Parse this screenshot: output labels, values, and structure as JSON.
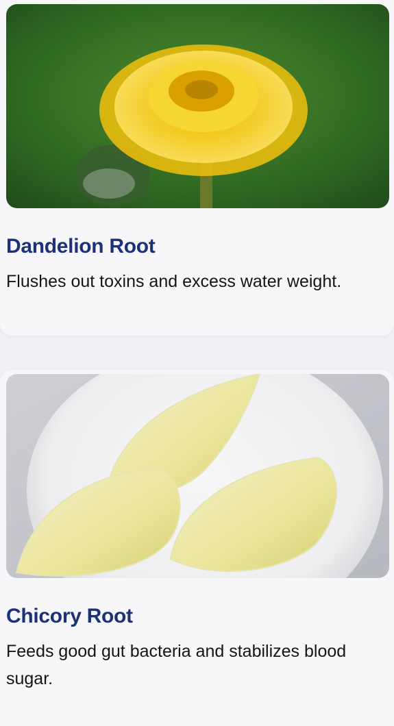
{
  "cards": [
    {
      "image_subject": "yellow dandelion flower on green background",
      "title": "Dandelion Root",
      "description": "Flushes out toxins and excess water weight."
    },
    {
      "image_subject": "pale yellow chicory endive heads on white plate",
      "title": "Chicory Root",
      "description": "Feeds good gut bacteria and stabilizes blood sugar."
    }
  ],
  "colors": {
    "title": "#1d3276",
    "text": "#151515",
    "card_background": "#f7f7f9",
    "page_background": "#f1f1f5"
  }
}
